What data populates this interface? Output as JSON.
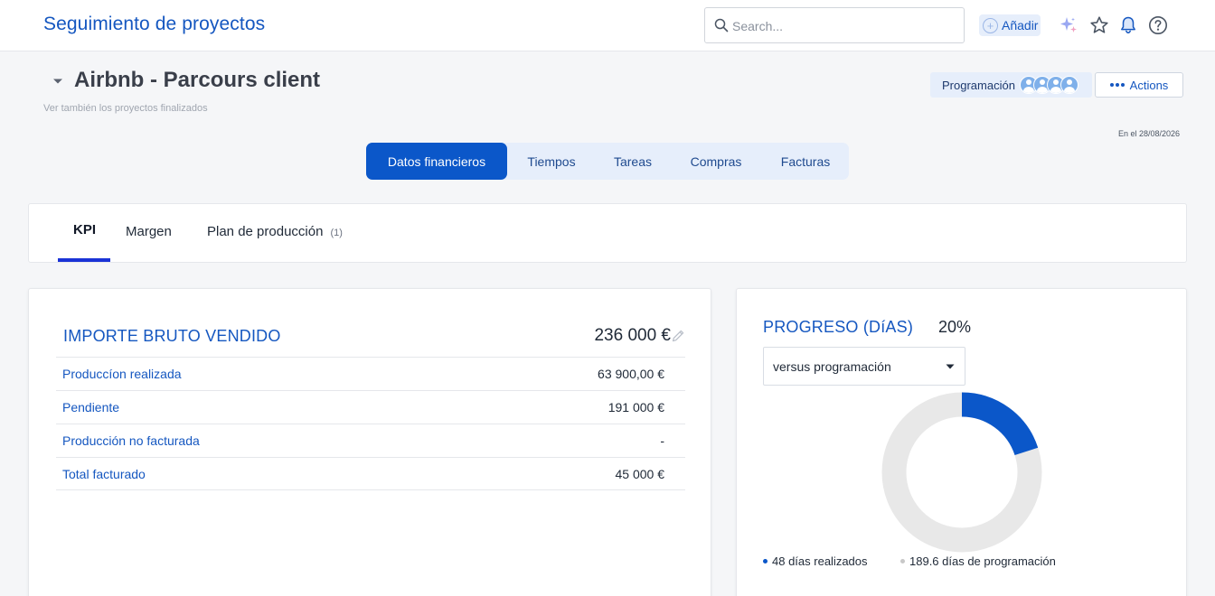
{
  "header": {
    "app_title": "Seguimiento de proyectos",
    "search_placeholder": "Search...",
    "add_label": "Añadir",
    "icons": [
      "sparkle-icon",
      "star-icon",
      "bell-icon",
      "help-icon"
    ]
  },
  "project": {
    "title": "Airbnb - Parcours client",
    "subtitle": "Ver también los proyectos finalizados",
    "planning_label": "Programación",
    "avatar_count": 4,
    "actions_label": "Actions",
    "date_note": "En el 28/08/2026"
  },
  "main_tabs": [
    {
      "label": "Datos financieros",
      "active": true
    },
    {
      "label": "Tiempos",
      "active": false
    },
    {
      "label": "Tareas",
      "active": false
    },
    {
      "label": "Compras",
      "active": false
    },
    {
      "label": "Facturas",
      "active": false
    }
  ],
  "sub_tabs": [
    {
      "label": "KPI",
      "active": true
    },
    {
      "label": "Margen",
      "active": false
    },
    {
      "label": "Plan de producción",
      "count": "(1)",
      "active": false
    }
  ],
  "kpi": {
    "title": "IMPORTE BRUTO VENDIDO",
    "total": "236 000 €",
    "rows": [
      {
        "label": "Produccíon realizada",
        "value": "63 900,00 €"
      },
      {
        "label": "Pendiente",
        "value": "191 000 €"
      },
      {
        "label": "Producción no facturada",
        "value": "-"
      },
      {
        "label": "Total facturado",
        "value": "45 000 €"
      }
    ]
  },
  "progress": {
    "title": "PROGRESO (DíAS)",
    "percent": "20%",
    "select_value": "versus programación",
    "legend_done": "48 días realizados",
    "legend_planned": "189.6 días de programación",
    "done_fraction": 0.2,
    "colors": {
      "done": "#0b57c9",
      "remaining": "#e8e8e8",
      "legend_planned_dot": "#c8c8c8"
    }
  }
}
